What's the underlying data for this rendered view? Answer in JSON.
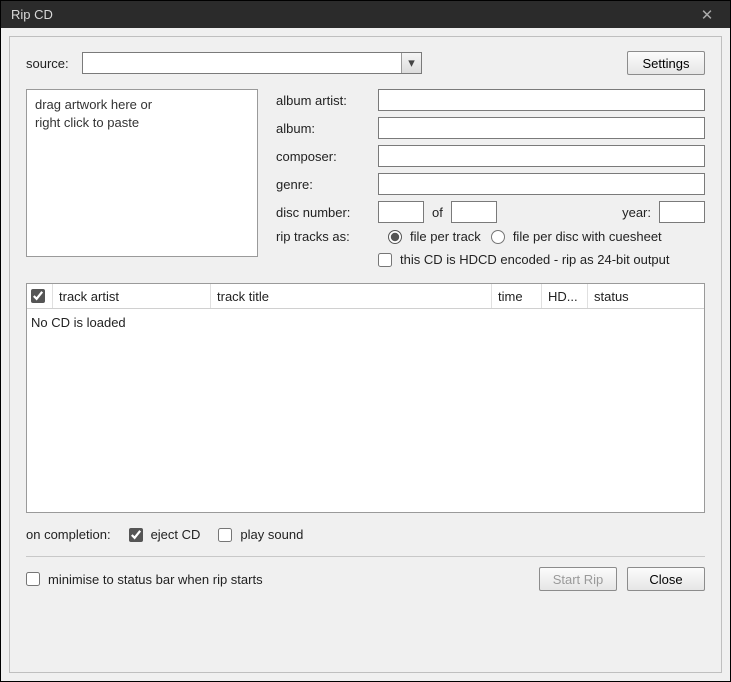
{
  "window": {
    "title": "Rip CD"
  },
  "source": {
    "label": "source:",
    "value": ""
  },
  "buttons": {
    "settings": "Settings",
    "start_rip": "Start Rip",
    "close": "Close"
  },
  "artwork": {
    "placeholder_line1": "drag artwork here or",
    "placeholder_line2": "right click to paste"
  },
  "meta": {
    "album_artist_label": "album artist:",
    "album_artist_value": "",
    "album_label": "album:",
    "album_value": "",
    "composer_label": "composer:",
    "composer_value": "",
    "genre_label": "genre:",
    "genre_value": "",
    "disc_number_label": "disc number:",
    "disc_number_value": "",
    "disc_of_label": "of",
    "disc_total_value": "",
    "year_label": "year:",
    "year_value": ""
  },
  "rip_as": {
    "label": "rip tracks as:",
    "option_per_track": "file per track",
    "option_per_disc": "file per disc with cuesheet",
    "selected": "per_track"
  },
  "hdcd": {
    "label": "this CD is HDCD encoded - rip as 24-bit output",
    "checked": false
  },
  "table": {
    "headers": {
      "track_artist": "track artist",
      "track_title": "track title",
      "time": "time",
      "hd": "HD...",
      "status": "status"
    },
    "header_check": true,
    "empty_message": "No CD is loaded",
    "rows": []
  },
  "completion": {
    "label": "on completion:",
    "eject_label": "eject CD",
    "eject_checked": true,
    "play_sound_label": "play sound",
    "play_sound_checked": false
  },
  "minimise": {
    "label": "minimise to status bar when rip starts",
    "checked": false
  },
  "start_rip_enabled": false
}
